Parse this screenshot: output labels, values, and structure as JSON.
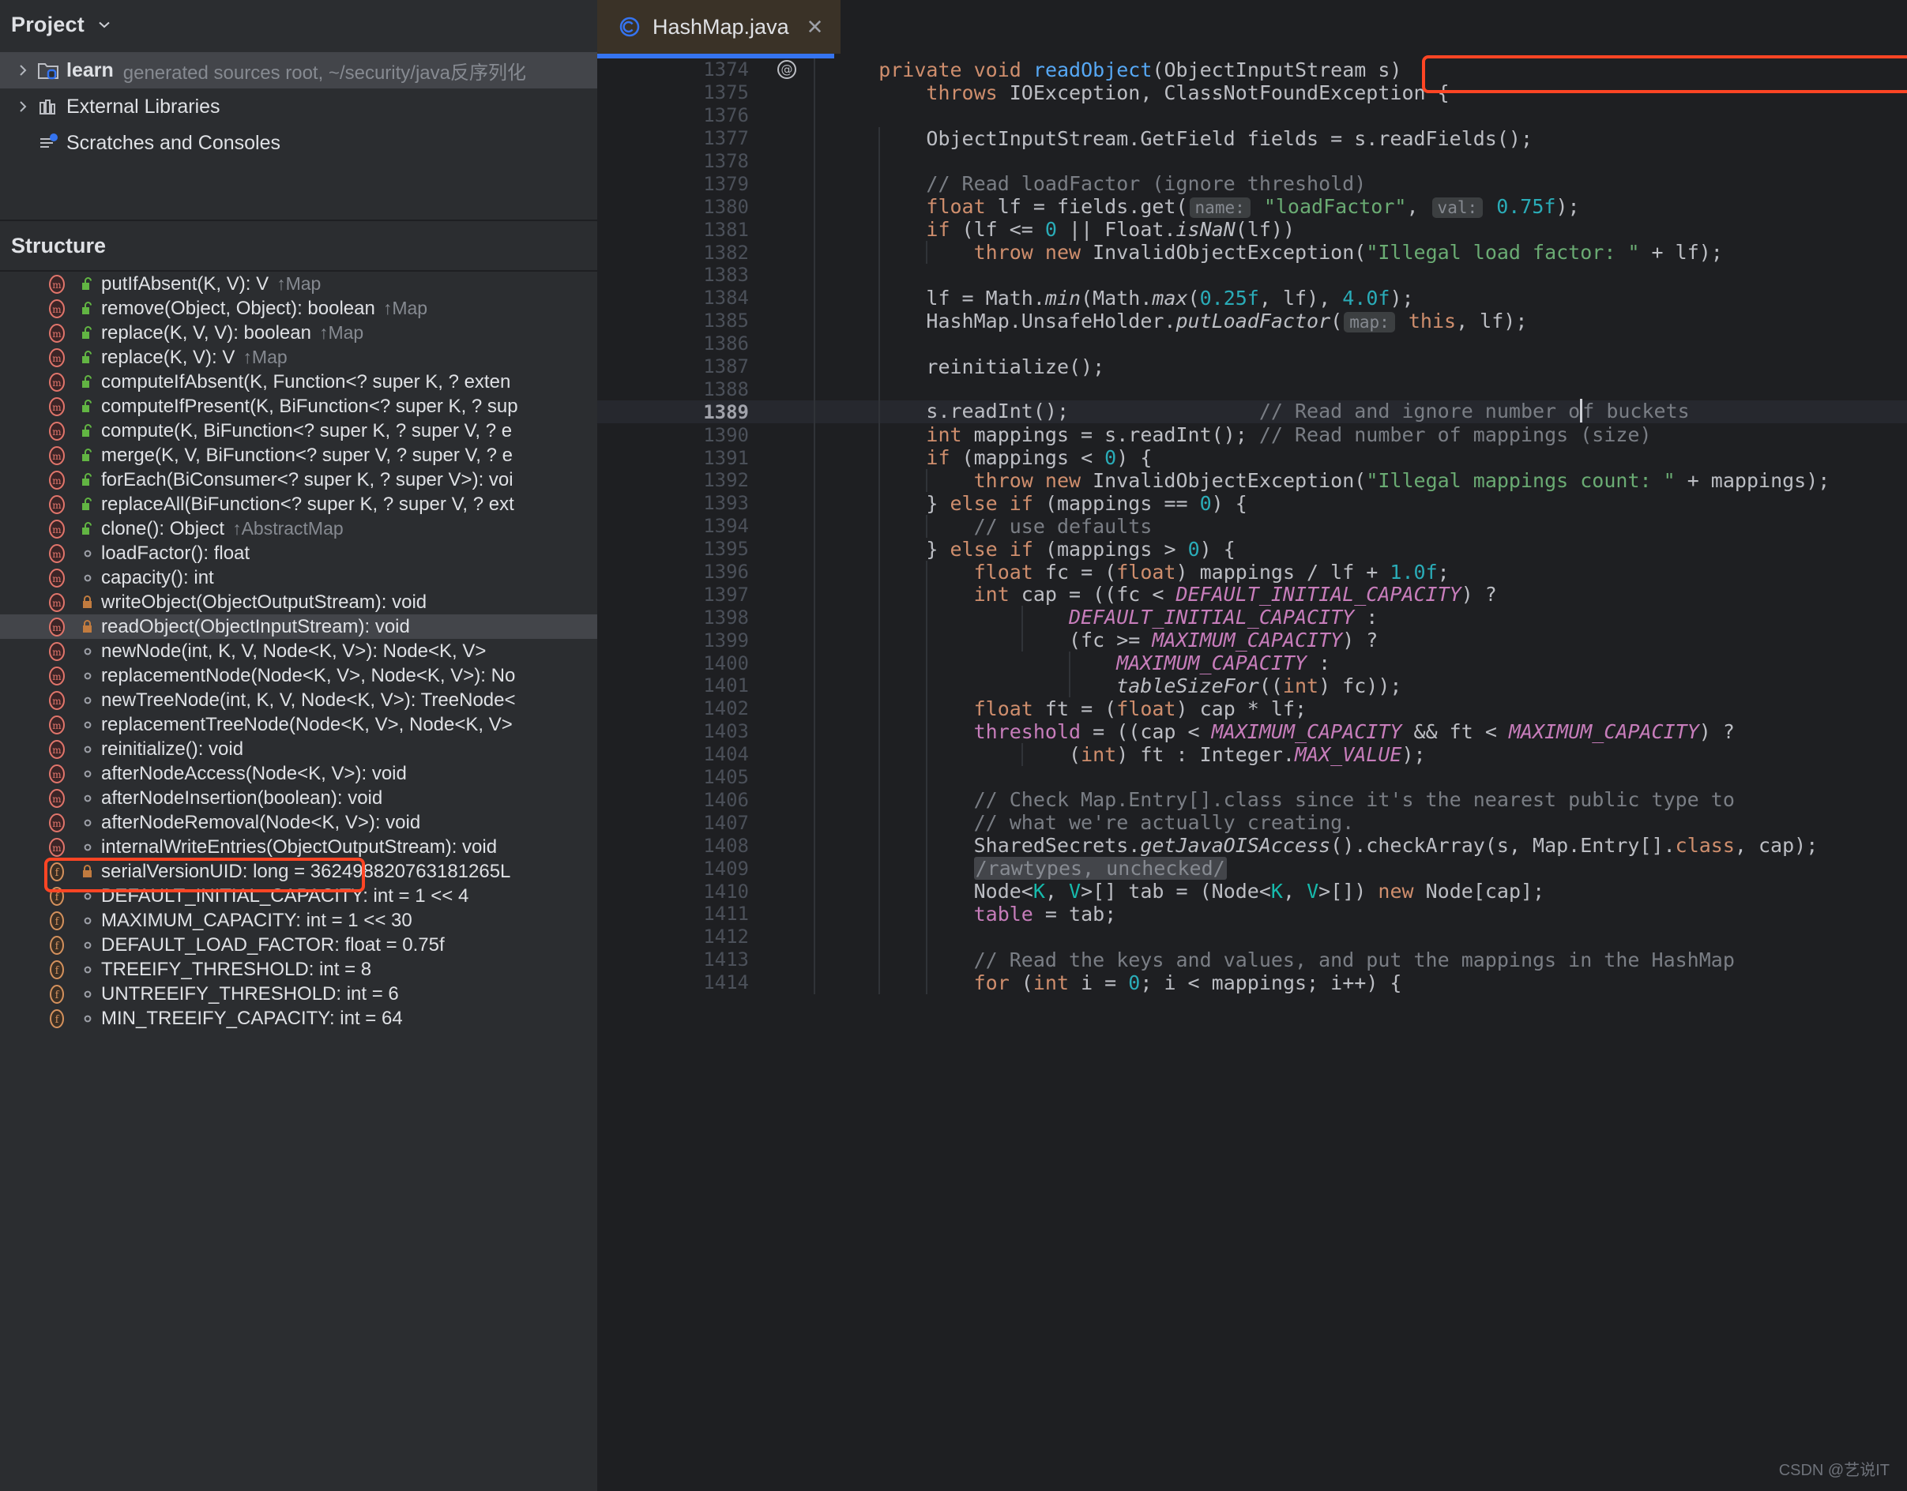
{
  "project_panel": {
    "title": "Project",
    "chevron_icon": "chevron-down-icon",
    "tree": [
      {
        "label": "learn",
        "sub": "generated sources root, ~/security/java反序列化",
        "icon": "folder-module-icon",
        "arrow": "chevron-right-icon",
        "selected": true,
        "bold": true
      },
      {
        "label": "External Libraries",
        "sub": "",
        "icon": "libraries-icon",
        "arrow": "chevron-right-icon",
        "selected": false,
        "bold": false
      },
      {
        "label": "Scratches and Consoles",
        "sub": "",
        "icon": "scratches-icon",
        "arrow": "",
        "selected": false,
        "bold": false
      }
    ]
  },
  "structure_panel": {
    "title": "Structure",
    "items": [
      {
        "kind": "method",
        "vis": "public",
        "label": "putIfAbsent(K, V): V",
        "inherit": "↑Map"
      },
      {
        "kind": "method",
        "vis": "public",
        "label": "remove(Object, Object): boolean",
        "inherit": "↑Map"
      },
      {
        "kind": "method",
        "vis": "public",
        "label": "replace(K, V, V): boolean",
        "inherit": "↑Map"
      },
      {
        "kind": "method",
        "vis": "public",
        "label": "replace(K, V): V",
        "inherit": "↑Map"
      },
      {
        "kind": "method",
        "vis": "public",
        "label": "computeIfAbsent(K, Function<? super K, ? exten",
        "inherit": ""
      },
      {
        "kind": "method",
        "vis": "public",
        "label": "computeIfPresent(K, BiFunction<? super K, ? sup",
        "inherit": ""
      },
      {
        "kind": "method",
        "vis": "public",
        "label": "compute(K, BiFunction<? super K, ? super V, ? e",
        "inherit": ""
      },
      {
        "kind": "method",
        "vis": "public",
        "label": "merge(K, V, BiFunction<? super V, ? super V, ? e",
        "inherit": ""
      },
      {
        "kind": "method",
        "vis": "public",
        "label": "forEach(BiConsumer<? super K, ? super V>): voi",
        "inherit": ""
      },
      {
        "kind": "method",
        "vis": "public",
        "label": "replaceAll(BiFunction<? super K, ? super V, ? ext",
        "inherit": ""
      },
      {
        "kind": "method",
        "vis": "public",
        "label": "clone(): Object",
        "inherit": "↑AbstractMap"
      },
      {
        "kind": "method",
        "vis": "package",
        "label": "loadFactor(): float",
        "inherit": ""
      },
      {
        "kind": "method",
        "vis": "package",
        "label": "capacity(): int",
        "inherit": ""
      },
      {
        "kind": "method",
        "vis": "private",
        "label": "writeObject(ObjectOutputStream): void",
        "inherit": ""
      },
      {
        "kind": "method",
        "vis": "private",
        "label": "readObject(ObjectInputStream): void",
        "inherit": "",
        "selected": true,
        "annotated": true
      },
      {
        "kind": "method",
        "vis": "package",
        "label": "newNode(int, K, V, Node<K, V>): Node<K, V>",
        "inherit": ""
      },
      {
        "kind": "method",
        "vis": "package",
        "label": "replacementNode(Node<K, V>, Node<K, V>): No",
        "inherit": ""
      },
      {
        "kind": "method",
        "vis": "package",
        "label": "newTreeNode(int, K, V, Node<K, V>): TreeNode<",
        "inherit": ""
      },
      {
        "kind": "method",
        "vis": "package",
        "label": "replacementTreeNode(Node<K, V>, Node<K, V>",
        "inherit": ""
      },
      {
        "kind": "method",
        "vis": "package",
        "label": "reinitialize(): void",
        "inherit": ""
      },
      {
        "kind": "method",
        "vis": "package",
        "label": "afterNodeAccess(Node<K, V>): void",
        "inherit": ""
      },
      {
        "kind": "method",
        "vis": "package",
        "label": "afterNodeInsertion(boolean): void",
        "inherit": ""
      },
      {
        "kind": "method",
        "vis": "package",
        "label": "afterNodeRemoval(Node<K, V>): void",
        "inherit": ""
      },
      {
        "kind": "method",
        "vis": "package",
        "label": "internalWriteEntries(ObjectOutputStream): void",
        "inherit": ""
      },
      {
        "kind": "field",
        "vis": "private",
        "label": "serialVersionUID: long = 362498820763181265L",
        "inherit": ""
      },
      {
        "kind": "field",
        "vis": "package",
        "label": "DEFAULT_INITIAL_CAPACITY: int = 1 << 4",
        "inherit": ""
      },
      {
        "kind": "field",
        "vis": "package",
        "label": "MAXIMUM_CAPACITY: int = 1 << 30",
        "inherit": ""
      },
      {
        "kind": "field",
        "vis": "package",
        "label": "DEFAULT_LOAD_FACTOR: float = 0.75f",
        "inherit": ""
      },
      {
        "kind": "field",
        "vis": "package",
        "label": "TREEIFY_THRESHOLD: int = 8",
        "inherit": ""
      },
      {
        "kind": "field",
        "vis": "package",
        "label": "UNTREEIFY_THRESHOLD: int = 6",
        "inherit": ""
      },
      {
        "kind": "field",
        "vis": "package",
        "label": "MIN_TREEIFY_CAPACITY: int = 64",
        "inherit": ""
      }
    ]
  },
  "editor": {
    "tab": {
      "label": "HashMap.java",
      "file_icon": "java-class-icon",
      "close_icon": "close-icon",
      "active": true
    },
    "gutter_annotation_icon": "annotation-at-icon",
    "current_line": 1389,
    "first_line": 1374,
    "caret": {
      "line": 1389,
      "text_before": "        s.readInt();                 // Read and ignore number o",
      "text_after": "f buckets"
    },
    "lines": [
      {
        "n": 1374,
        "gutter_icon": "annotation-at-icon",
        "annotated": true
      },
      {
        "n": 1375
      },
      {
        "n": 1376
      },
      {
        "n": 1377
      },
      {
        "n": 1378
      },
      {
        "n": 1379
      },
      {
        "n": 1380
      },
      {
        "n": 1381
      },
      {
        "n": 1382
      },
      {
        "n": 1383
      },
      {
        "n": 1384
      },
      {
        "n": 1385
      },
      {
        "n": 1386
      },
      {
        "n": 1387
      },
      {
        "n": 1388
      },
      {
        "n": 1389,
        "current": true
      },
      {
        "n": 1390
      },
      {
        "n": 1391
      },
      {
        "n": 1392
      },
      {
        "n": 1393
      },
      {
        "n": 1394
      },
      {
        "n": 1395
      },
      {
        "n": 1396
      },
      {
        "n": 1397
      },
      {
        "n": 1398
      },
      {
        "n": 1399
      },
      {
        "n": 1400
      },
      {
        "n": 1401
      },
      {
        "n": 1402
      },
      {
        "n": 1403
      },
      {
        "n": 1404
      },
      {
        "n": 1405
      },
      {
        "n": 1406
      },
      {
        "n": 1407
      },
      {
        "n": 1408
      },
      {
        "n": 1409
      },
      {
        "n": 1410
      },
      {
        "n": 1411
      },
      {
        "n": 1412
      },
      {
        "n": 1413
      },
      {
        "n": 1414
      }
    ],
    "source_text": [
      "    private void readObject(ObjectInputStream s)",
      "        throws IOException, ClassNotFoundException {",
      "",
      "        ObjectInputStream.GetField fields = s.readFields();",
      "",
      "        // Read loadFactor (ignore threshold)",
      "        float lf = fields.get( name: \"loadFactor\",  val: 0.75f);",
      "        if (lf <= 0 || Float.isNaN(lf))",
      "            throw new InvalidObjectException(\"Illegal load factor: \" + lf);",
      "",
      "        lf = Math.min(Math.max(0.25f, lf), 4.0f);",
      "        HashMap.UnsafeHolder.putLoadFactor( map: this, lf);",
      "",
      "        reinitialize();",
      "",
      "        s.readInt();                // Read and ignore number of buckets",
      "        int mappings = s.readInt(); // Read number of mappings (size)",
      "        if (mappings < 0) {",
      "            throw new InvalidObjectException(\"Illegal mappings count: \" + mappings);",
      "        } else if (mappings == 0) {",
      "            // use defaults",
      "        } else if (mappings > 0) {",
      "            float fc = (float) mappings / lf + 1.0f;",
      "            int cap = ((fc < DEFAULT_INITIAL_CAPACITY) ?",
      "                    DEFAULT_INITIAL_CAPACITY :",
      "                    (fc >= MAXIMUM_CAPACITY) ?",
      "                        MAXIMUM_CAPACITY :",
      "                        tableSizeFor((int) fc));",
      "            float ft = (float) cap * lf;",
      "            threshold = ((cap < MAXIMUM_CAPACITY && ft < MAXIMUM_CAPACITY) ?",
      "                    (int) ft : Integer.MAX_VALUE);",
      "",
      "            // Check Map.Entry[].class since it's the nearest public type to",
      "            // what we're actually creating.",
      "            SharedSecrets.getJavaOISAccess().checkArray(s, Map.Entry[].class, cap);",
      "            /rawtypes, unchecked/",
      "            Node<K, V>[] tab = (Node<K, V>[]) new Node[cap];",
      "            table = tab;",
      "",
      "            // Read the keys and values, and put the mappings in the HashMap",
      "            for (int i = 0; i < mappings; i++) {"
    ]
  },
  "watermark": "CSDN @艺说IT",
  "colors": {
    "accent": "#3574F0",
    "annotation_box": "#FF4524",
    "keyword": "#CF8E6D",
    "string": "#6AAB73",
    "number": "#2AACB8",
    "comment": "#7A7E85",
    "static_field": "#C77DBB",
    "generic": "#16BAAC",
    "declaration": "#56A8F5",
    "editor_bg": "#1E1F22",
    "panel_bg": "#2B2D30",
    "selection_bg": "#43454A"
  }
}
